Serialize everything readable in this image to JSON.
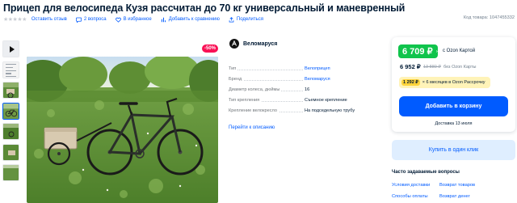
{
  "product": {
    "title": "Прицеп для велосипеда Кузя рассчитан до 70 кг универсальный и маневренный",
    "code": "Код товара: 1047455332",
    "discount": "-50%"
  },
  "meta": {
    "rating_stars": "★★★★★",
    "review": "Оставить отзыв",
    "questions": "2 вопроса",
    "favorites": "В избранное",
    "compare": "Добавить к сравнению",
    "share": "Поделиться"
  },
  "brand": {
    "name": "Веломаруся"
  },
  "specs": [
    {
      "label": "Тип",
      "value": "Велоприцеп",
      "is_link": true
    },
    {
      "label": "Бренд",
      "value": "Веломаруся",
      "is_link": true
    },
    {
      "label": "Диаметр колеса, дюймы",
      "value": "16",
      "is_link": false
    },
    {
      "label": "Тип крепления",
      "value": "Съемное крепление",
      "is_link": false
    },
    {
      "label": "Крепление велокресло",
      "value": "На подседельную трубу",
      "is_link": false
    }
  ],
  "to_description": "Перейти к описанию",
  "buy": {
    "price_card": "6 709 ₽",
    "price_card_label": "c Ozon Картой",
    "price": "6 952 ₽",
    "old_price": "13 880 ₽",
    "no_card_label": "без Ozon Карты",
    "installment_amount": "1 292 ₽",
    "installment_text": "× 6 месяцев в Ozon Рассрочку",
    "add_to_cart": "Добавить в корзину",
    "delivery": "Доставка 13 июля",
    "one_click": "Купить в один клик"
  },
  "faq": {
    "title": "Часто задаваемые вопросы",
    "links": [
      "Условия доставки",
      "Возврат товаров",
      "Способы оплаты",
      "Возврат денег"
    ]
  },
  "colors": {
    "accent": "#005bff",
    "green_price": "#10c44c",
    "discount": "#f91155",
    "installment_bg": "#fff3b8"
  }
}
